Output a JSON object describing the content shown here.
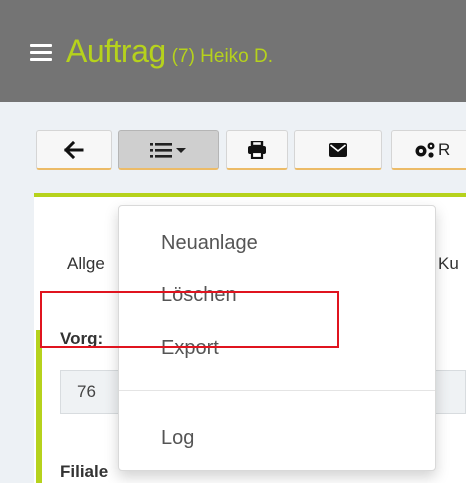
{
  "header": {
    "title": "Auftrag",
    "subtitle": "(7) Heiko D."
  },
  "toolbar": {
    "buttons": [
      {
        "icon": "arrow-left-icon"
      },
      {
        "icon": "list-icon",
        "has_caret": true,
        "active": true
      },
      {
        "icon": "print-icon"
      },
      {
        "icon": "envelope-icon"
      },
      {
        "icon": "gears-icon",
        "label": "R"
      }
    ]
  },
  "tabs": {
    "left": "Allge",
    "right": "Ku"
  },
  "form": {
    "vorgang_label": "Vorg:",
    "vorgang_value": "76",
    "filiale_label": "Filiale"
  },
  "menu": {
    "items": [
      "Neuanlage",
      "Löschen",
      "Export"
    ],
    "log": "Log"
  },
  "colors": {
    "header_bg": "#747474",
    "accent_green": "#b6d21c",
    "button_underline": "#ecbb67",
    "highlight_red": "#e0141f"
  }
}
